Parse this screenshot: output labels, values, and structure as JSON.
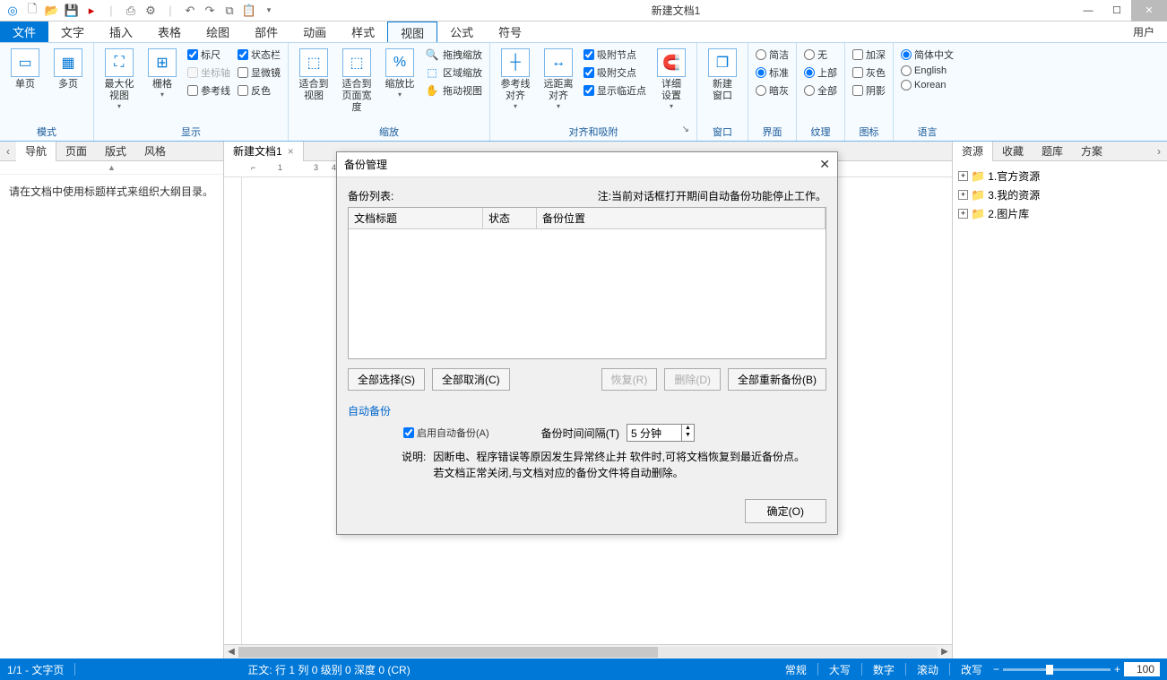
{
  "window": {
    "title": "新建文档1"
  },
  "menubar": {
    "file": "文件",
    "tabs": [
      "文字",
      "插入",
      "表格",
      "绘图",
      "部件",
      "动画",
      "样式",
      "视图",
      "公式",
      "符号"
    ],
    "active": "视图",
    "user": "用户"
  },
  "ribbon": {
    "groups": {
      "mode": {
        "label": "模式",
        "single": "单页",
        "multi": "多页",
        "maxview": "最大化\n视图",
        "grid": "栅格"
      },
      "display": {
        "label": "显示",
        "ruler": "标尺",
        "status": "状态栏",
        "axis": "坐标轴",
        "micro": "显微镜",
        "guide": "参考线",
        "invert": "反色"
      },
      "zoom": {
        "label": "缩放",
        "fitview": "适合到\n视图",
        "fitpage": "适合到\n页面宽度",
        "ratio": "缩放比",
        "drag": "拖拽缩放",
        "region": "区域缩放",
        "pan": "拖动视图"
      },
      "align": {
        "label": "对齐和吸附",
        "guides": "参考线\n对齐",
        "far": "远距离\n对齐",
        "node": "吸附节点",
        "cross": "吸附交点",
        "near": "显示临近点",
        "detail": "详细\n设置"
      },
      "window": {
        "label": "窗口",
        "new": "新建\n窗口"
      },
      "ui": {
        "label": "界面",
        "simple": "简洁",
        "standard": "标准",
        "dark": "暗灰"
      },
      "texture": {
        "label": "纹理",
        "none": "无",
        "top": "上部",
        "all": "全部"
      },
      "icon": {
        "label": "图标",
        "deep": "加深",
        "gray": "灰色",
        "shadow": "阴影"
      },
      "lang": {
        "label": "语言",
        "cn": "简体中文",
        "en": "English",
        "kr": "Korean"
      }
    }
  },
  "left_panel": {
    "tabs": [
      "导航",
      "页面",
      "版式",
      "风格"
    ],
    "active": "导航",
    "hint": "请在文档中使用标题样式来组织大纲目录。"
  },
  "doc_tabs": {
    "tab1": "新建文档1"
  },
  "ruler_marks": [
    "1",
    "3",
    "4"
  ],
  "right_panel": {
    "tabs": [
      "资源",
      "收藏",
      "题库",
      "方案"
    ],
    "active": "资源",
    "nodes": [
      "1.官方资源",
      "3.我的资源",
      "2.图片库"
    ]
  },
  "statusbar": {
    "page": "1/1 - 文字页",
    "pos": "正文: 行 1   列 0   级别 0   深度 0 (CR)",
    "mode": "常规",
    "indicators": [
      "大写",
      "数字",
      "滚动",
      "改写"
    ],
    "zoom": "100"
  },
  "dialog": {
    "title": "备份管理",
    "list_label": "备份列表:",
    "note": "注:当前对话框打开期间自动备份功能停止工作。",
    "cols": {
      "title": "文档标题",
      "status": "状态",
      "loc": "备份位置"
    },
    "btns": {
      "selall": "全部选择(S)",
      "desall": "全部取消(C)",
      "restore": "恢复(R)",
      "delete": "删除(D)",
      "rebackup": "全部重新备份(B)"
    },
    "auto_section": "自动备份",
    "enable_label": "启用自动备份(A)",
    "interval_label": "备份时间间隔(T)",
    "interval_value": "5 分钟",
    "desc_label": "说明:",
    "desc_line1": "因断电、程序错误等原因发生异常终止并 软件时,可将文档恢复到最近备份点。",
    "desc_line2": "若文档正常关闭,与文档对应的备份文件将自动删除。",
    "ok": "确定(O)"
  }
}
